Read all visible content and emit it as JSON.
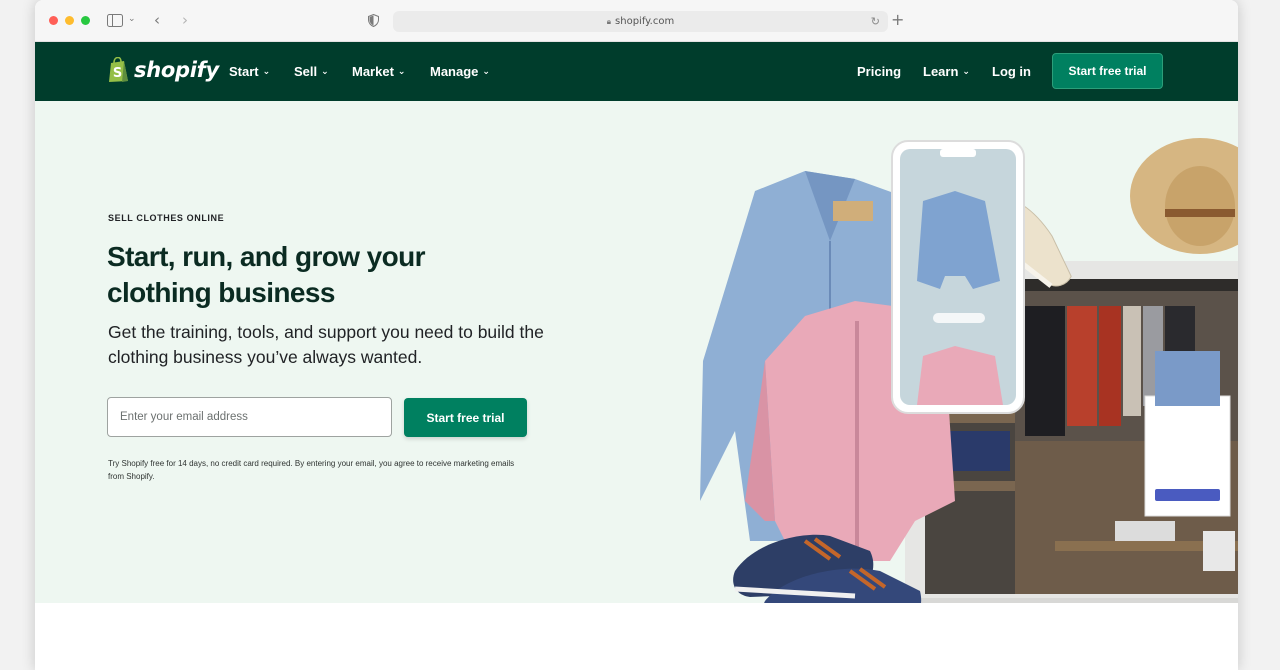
{
  "browser": {
    "url": "shopify.com",
    "traffic_light_colors": [
      "#ff5f57",
      "#febc2e",
      "#28c840"
    ],
    "icons": [
      "sidebar-icon",
      "back-icon",
      "forward-icon",
      "shield-icon",
      "lock-icon",
      "reload-icon",
      "new-tab-icon"
    ]
  },
  "nav": {
    "logo_text": "shopify",
    "items": [
      {
        "label": "Start",
        "has_dropdown": true
      },
      {
        "label": "Sell",
        "has_dropdown": true
      },
      {
        "label": "Market",
        "has_dropdown": true
      },
      {
        "label": "Manage",
        "has_dropdown": true
      }
    ],
    "right": {
      "pricing": "Pricing",
      "learn": "Learn",
      "login": "Log in",
      "cta": "Start free trial"
    },
    "bg_color": "#003d2c",
    "cta_color": "#008060"
  },
  "hero": {
    "eyebrow": "SELL CLOTHES ONLINE",
    "headline": "Start, run, and grow your clothing business",
    "subhead": "Get the training, tools, and support you need to build the clothing business you’ve always wanted.",
    "email_placeholder": "Enter your email address",
    "cta": "Start free trial",
    "fine_print": "Try Shopify free for 14 days, no credit card required. By entering your email, you agree to receive marketing emails from Shopify.",
    "bg_color": "#eef7f1"
  }
}
